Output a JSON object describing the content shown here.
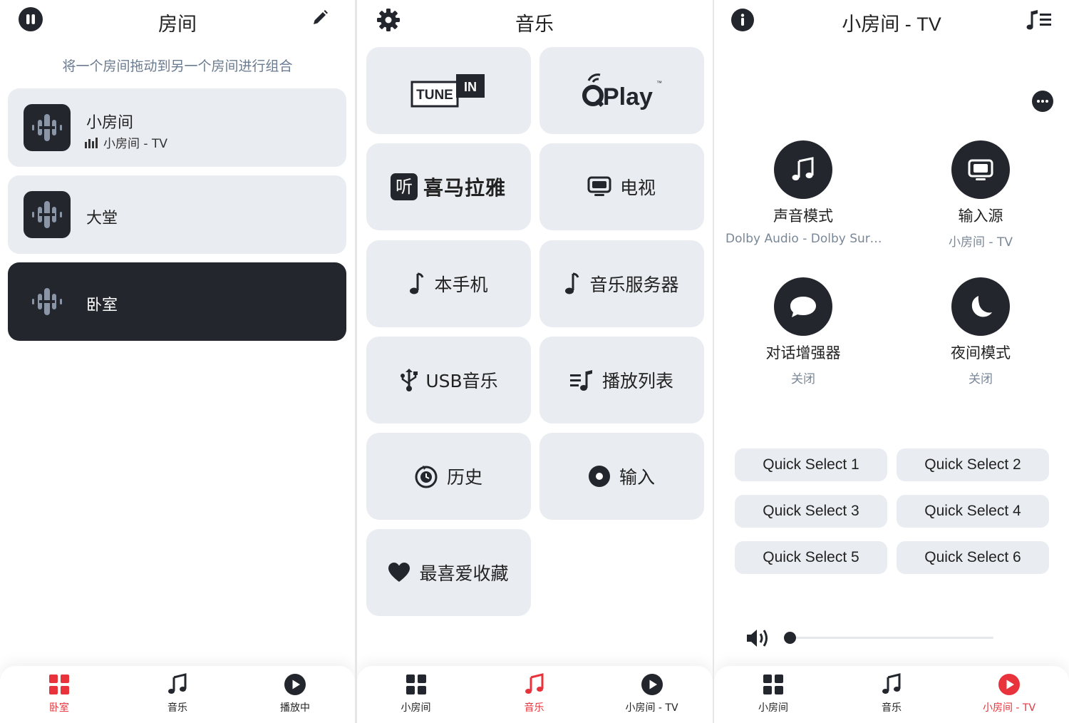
{
  "colors": {
    "accent": "#e8333c",
    "dark": "#23262d",
    "card": "#e9ecf0",
    "muted": "#6b7b90"
  },
  "rooms_screen": {
    "title": "房间",
    "hint": "将一个房间拖动到另一个房间进行组合",
    "rooms": [
      {
        "name": "小房间",
        "playing": "小房间 - TV",
        "active": false
      },
      {
        "name": "大堂",
        "playing": "",
        "active": false
      },
      {
        "name": "卧室",
        "playing": "",
        "active": true
      }
    ],
    "nav": [
      {
        "label": "卧室",
        "icon": "grid-icon",
        "active": true
      },
      {
        "label": "音乐",
        "icon": "music-note-icon",
        "active": false
      },
      {
        "label": "播放中",
        "icon": "play-circle-icon",
        "active": false
      }
    ]
  },
  "music_screen": {
    "title": "音乐",
    "sources": [
      {
        "label": "",
        "logo": "TuneIn",
        "icon": "tunein-logo"
      },
      {
        "label": "",
        "logo": "QPlay",
        "icon": "qplay-logo"
      },
      {
        "label": "喜马拉雅",
        "logo": "听",
        "icon": "ximalaya-logo"
      },
      {
        "label": "电视",
        "icon": "tv-icon"
      },
      {
        "label": "本手机",
        "icon": "music-note-icon"
      },
      {
        "label": "音乐服务器",
        "icon": "music-note-icon"
      },
      {
        "label": "USB音乐",
        "icon": "usb-icon"
      },
      {
        "label": "播放列表",
        "icon": "playlist-icon"
      },
      {
        "label": "历史",
        "icon": "history-icon"
      },
      {
        "label": "输入",
        "icon": "input-icon"
      },
      {
        "label": "最喜爱收藏",
        "icon": "heart-icon"
      }
    ],
    "logo_texts": {
      "tune": "TUNE",
      "in": "IN",
      "qplay": "Play",
      "tm": "™"
    },
    "nav": [
      {
        "label": "小房间",
        "icon": "grid-icon",
        "active": false
      },
      {
        "label": "音乐",
        "icon": "music-note-icon",
        "active": true
      },
      {
        "label": "小房间 - TV",
        "icon": "play-circle-icon",
        "active": false
      }
    ]
  },
  "tv_screen": {
    "title": "小房间 - TV",
    "controls": [
      {
        "name": "声音模式",
        "value": "Dolby Audio - Dolby Surro...",
        "icon": "music-notes-icon"
      },
      {
        "name": "输入源",
        "value": "小房间 - TV",
        "icon": "monitor-icon"
      },
      {
        "name": "对话增强器",
        "value": "关闭",
        "icon": "speech-bubble-icon"
      },
      {
        "name": "夜间模式",
        "value": "关闭",
        "icon": "moon-icon"
      }
    ],
    "quick_selects": [
      "Quick Select 1",
      "Quick Select 2",
      "Quick Select 3",
      "Quick Select 4",
      "Quick Select 5",
      "Quick Select 6"
    ],
    "volume": 0,
    "nav": [
      {
        "label": "小房间",
        "icon": "grid-icon",
        "active": false
      },
      {
        "label": "音乐",
        "icon": "music-note-icon",
        "active": false
      },
      {
        "label": "小房间 - TV",
        "icon": "play-circle-icon",
        "active": true
      }
    ]
  }
}
